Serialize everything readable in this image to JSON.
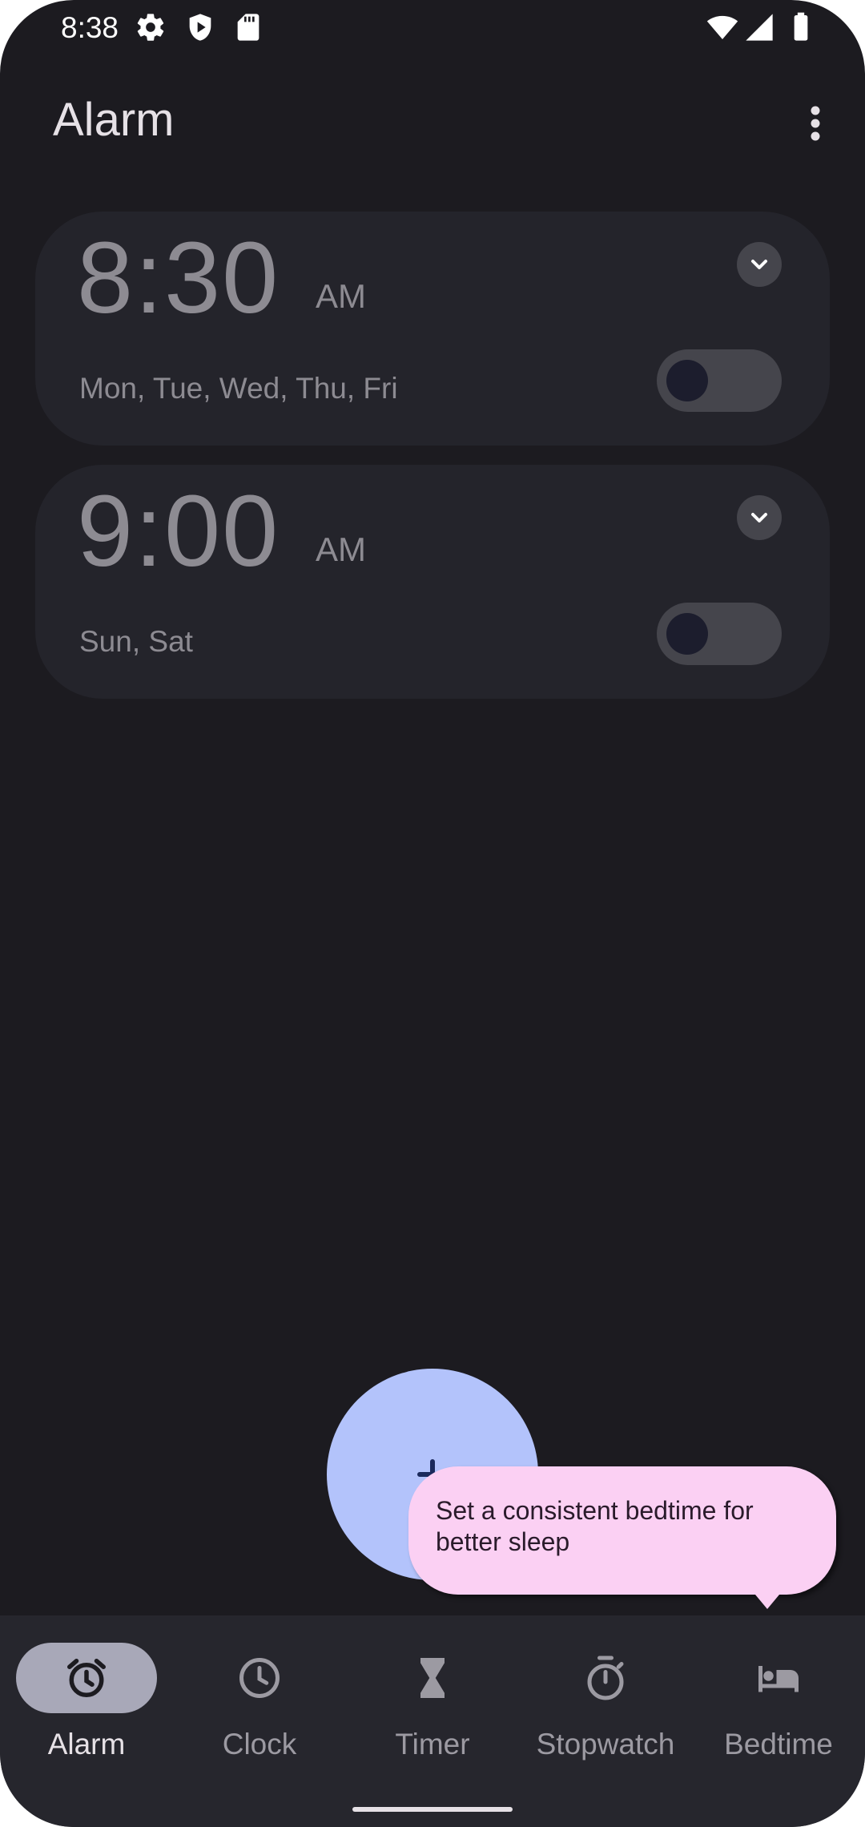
{
  "status_bar": {
    "time": "8:38",
    "left_icons": [
      "settings-icon",
      "play-protect-icon",
      "sd-card-icon"
    ],
    "right_icons": [
      "wifi-icon",
      "cell-signal-icon",
      "battery-icon"
    ]
  },
  "app_bar": {
    "title": "Alarm",
    "menu_icon": "more-vert-icon"
  },
  "alarms": [
    {
      "time": "8:30",
      "ampm": "AM",
      "days": "Mon, Tue, Wed, Thu, Fri",
      "enabled": false
    },
    {
      "time": "9:00",
      "ampm": "AM",
      "days": "Sun, Sat",
      "enabled": false
    }
  ],
  "fab": {
    "icon": "plus-icon"
  },
  "tooltip": {
    "text": "Set a consistent bedtime for better sleep"
  },
  "bottom_nav": {
    "items": [
      {
        "label": "Alarm",
        "icon": "alarm-icon",
        "active": true
      },
      {
        "label": "Clock",
        "icon": "clock-icon",
        "active": false
      },
      {
        "label": "Timer",
        "icon": "hourglass-icon",
        "active": false
      },
      {
        "label": "Stopwatch",
        "icon": "stopwatch-icon",
        "active": false
      },
      {
        "label": "Bedtime",
        "icon": "bed-icon",
        "active": false
      }
    ]
  },
  "colors": {
    "background": "#1c1b20",
    "card": "#24242b",
    "fab": "#b3c3fb",
    "tooltip": "#fbd0f3",
    "nav_active_pill": "#a8a8b8"
  }
}
